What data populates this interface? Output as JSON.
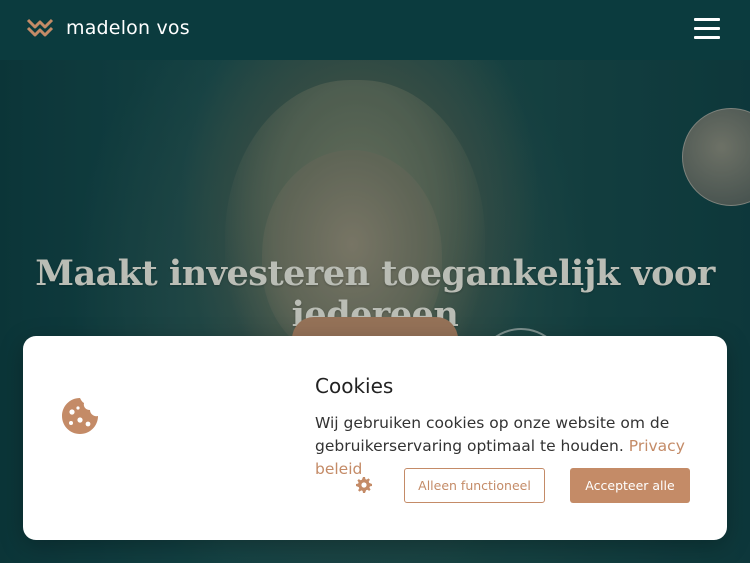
{
  "header": {
    "brand": "madelon vos",
    "logo_icon": "double-chevron-logo-icon",
    "menu_icon": "hamburger-menu-icon"
  },
  "hero": {
    "title": "Maakt investeren toegankelijk voor iedereen"
  },
  "cookie_banner": {
    "title": "Cookies",
    "text": "Wij gebruiken cookies op onze website om de gebruikerservaring optimaal te houden.",
    "link_label": "Privacy beleid",
    "settings_icon": "gear-icon",
    "cookie_icon": "cookie-icon",
    "functional_label": "Alleen functioneel",
    "accept_label": "Accepteer alle"
  },
  "colors": {
    "brand_dark": "#0b3b3e",
    "accent": "#c48b67",
    "white": "#ffffff"
  }
}
